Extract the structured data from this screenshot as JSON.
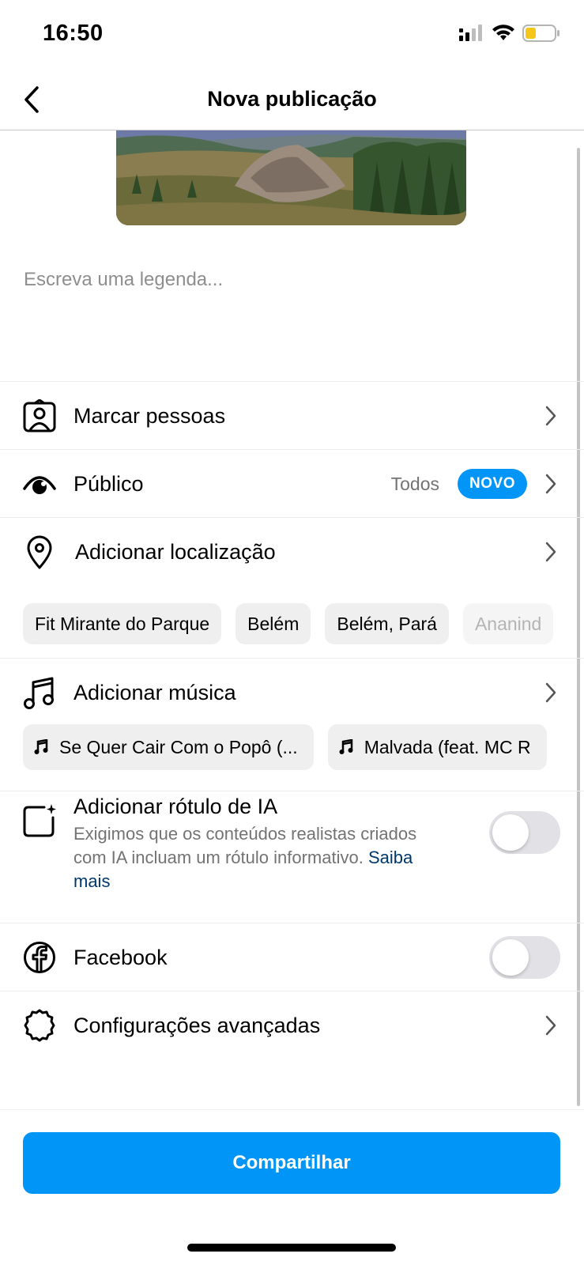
{
  "status_bar": {
    "time": "16:50",
    "icons": [
      "cellular-signal-icon",
      "wifi-icon",
      "battery-icon"
    ],
    "battery_color": "#f5c518"
  },
  "header": {
    "title": "Nova publicação",
    "back_icon": "chevron-left-icon"
  },
  "post": {
    "image_alt": "landscape",
    "caption_placeholder": "Escreva uma legenda..."
  },
  "options": {
    "tag_people": {
      "label": "Marcar pessoas",
      "icon": "tag-person-icon"
    },
    "audience": {
      "label": "Público",
      "value": "Todos",
      "badge": "NOVO",
      "icon": "eye-icon"
    },
    "location": {
      "label": "Adicionar localização",
      "icon": "location-pin-icon",
      "suggestions": [
        "Fit Mirante do Parque",
        "Belém",
        "Belém, Pará",
        "Ananind"
      ]
    },
    "music": {
      "label": "Adicionar música",
      "icon": "music-note-icon",
      "suggestions": [
        "Se Quer Cair Com o Popô (...",
        "Malvada (feat. MC R"
      ]
    },
    "ai_label": {
      "title": "Adicionar rótulo de IA",
      "description": "Exigimos que os conteúdos realistas criados com IA incluam um rótulo informativo.",
      "link": "Saiba mais",
      "enabled": false,
      "icon": "ai-label-icon"
    },
    "facebook": {
      "label": "Facebook",
      "enabled": false,
      "icon": "facebook-icon"
    },
    "advanced": {
      "label": "Configurações avançadas",
      "icon": "settings-gear-icon"
    }
  },
  "share_button": {
    "label": "Compartilhar"
  },
  "colors": {
    "accent": "#0095f6",
    "link": "#00376b",
    "secondary_text": "#737373",
    "toggle_off": "#e2e2e6"
  }
}
